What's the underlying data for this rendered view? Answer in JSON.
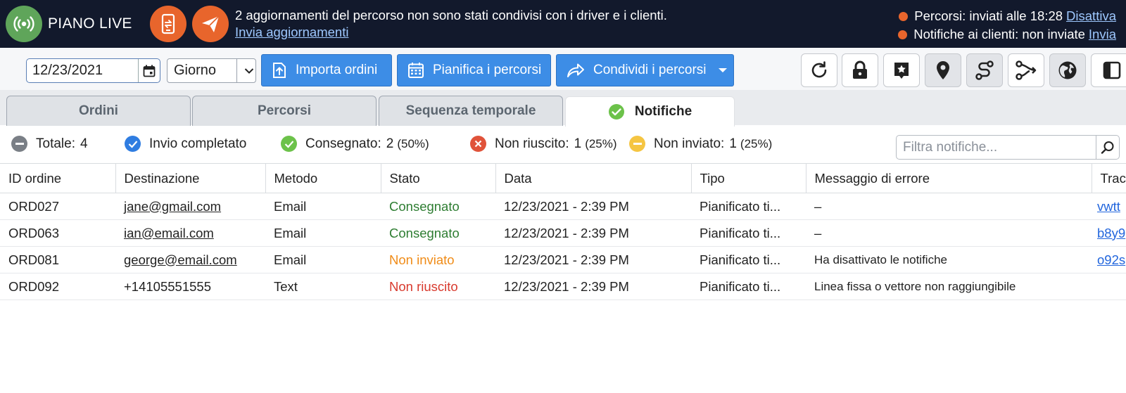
{
  "app": {
    "name": "PIANO LIVE"
  },
  "banner": {
    "message": "2 aggiornamenti del percorso non sono stati condivisi con i driver e i clienti.",
    "link": "Invia aggiornamenti",
    "routes_status": "Percorsi: inviati alle 18:28",
    "routes_action": "Disattiva",
    "notify_status": "Notifiche ai clienti: non inviate",
    "notify_action": "Invia",
    "status_dot_color": "#e8652c"
  },
  "toolbar": {
    "date_value": "12/23/2021",
    "period": "Giorno",
    "import_label": "Importa ordini",
    "plan_label": "Pianifica i percorsi",
    "share_label": "Condividi i percorsi",
    "icons": [
      "refresh-icon",
      "lock-icon",
      "bookmark-star-icon",
      "map-pin-icon",
      "route-icon",
      "route-branch-icon",
      "globe-icon",
      "sidebar-panel-icon"
    ]
  },
  "tabs": [
    {
      "label": "Ordini"
    },
    {
      "label": "Percorsi"
    },
    {
      "label": "Sequenza temporale"
    },
    {
      "label": "Notifiche",
      "active": true
    }
  ],
  "summary": {
    "total_label": "Totale:",
    "total_value": "4",
    "complete_label": "Invio completato",
    "delivered_label": "Consegnato:",
    "delivered_value": "2",
    "delivered_pct": "(50%)",
    "failed_label": "Non riuscito:",
    "failed_value": "1",
    "failed_pct": "(25%)",
    "notsent_label": "Non inviato:",
    "notsent_value": "1",
    "notsent_pct": "(25%)",
    "filter_placeholder": "Filtra notifiche...",
    "colors": {
      "total": "#7a7f86",
      "complete": "#2f7de1",
      "delivered": "#6cc24a",
      "failed": "#e0533a",
      "notsent": "#f5c542"
    }
  },
  "table": {
    "columns": [
      "ID ordine",
      "Destinazione",
      "Metodo",
      "Stato",
      "Data",
      "Tipo",
      "Messaggio di errore",
      "Tracc"
    ],
    "rows": [
      {
        "id": "ORD027",
        "dest": "jane@gmail.com",
        "method": "Email",
        "status": "Consegnato",
        "date": "12/23/2021 - 2:39 PM",
        "type": "Pianificato ti...",
        "error": "–",
        "track": "vwtt"
      },
      {
        "id": "ORD063",
        "dest": "ian@email.com",
        "method": "Email",
        "status": "Consegnato",
        "date": "12/23/2021 - 2:39 PM",
        "type": "Pianificato ti...",
        "error": "–",
        "track": "b8y9"
      },
      {
        "id": "ORD081",
        "dest": "george@email.com",
        "method": "Email",
        "status": "Non inviato",
        "date": "12/23/2021 - 2:39 PM",
        "type": "Pianificato ti...",
        "error": "Ha disattivato le notifiche",
        "track": "o92s"
      },
      {
        "id": "ORD092",
        "dest": "+14105551555",
        "method": "Text",
        "status": "Non riuscito",
        "date": "12/23/2021 - 2:39 PM",
        "type": "Pianificato ti...",
        "error": "Linea fissa o vettore non raggiungibile",
        "track": ""
      }
    ]
  }
}
